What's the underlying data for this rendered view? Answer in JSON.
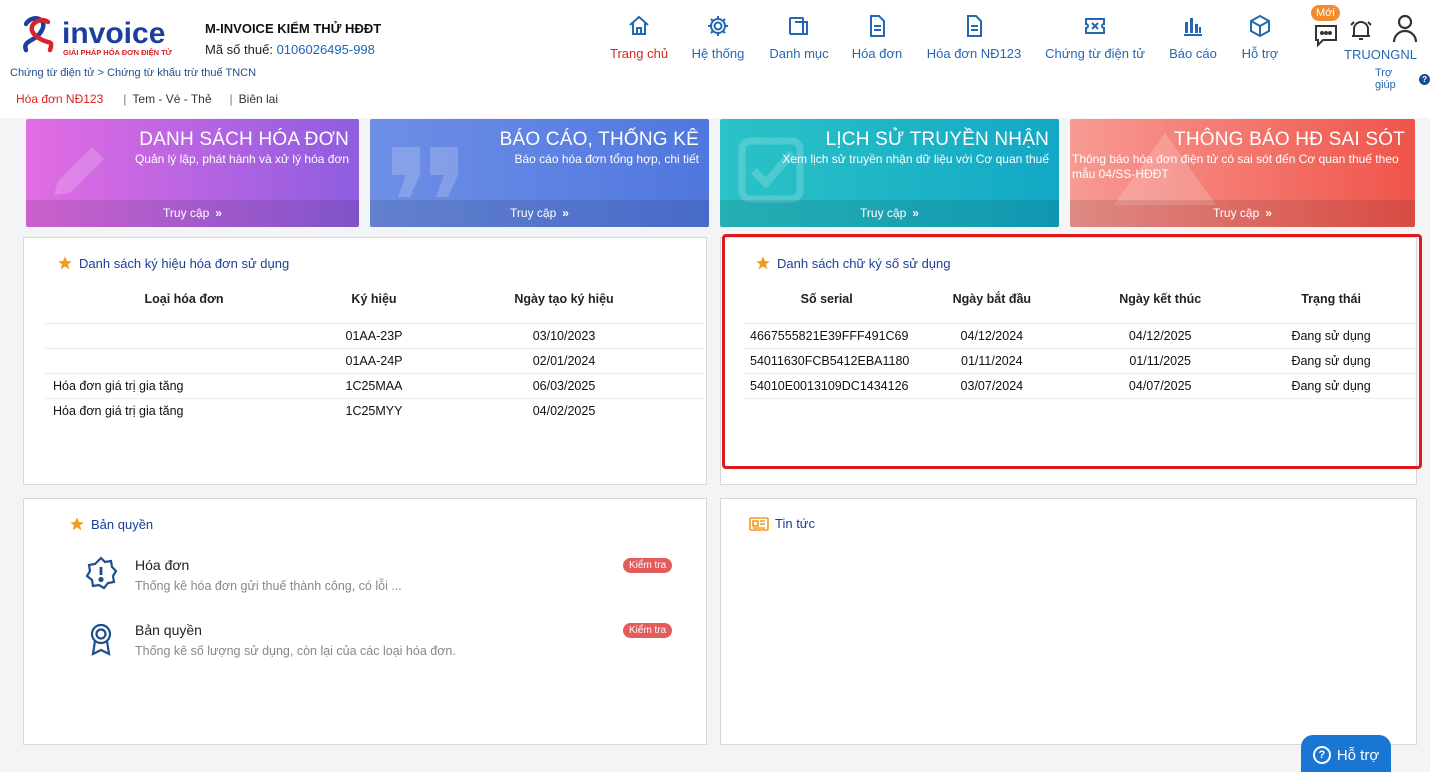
{
  "header": {
    "company_name": "M-INVOICE KIỂM THỬ HĐĐT",
    "tax_label": "Mã số thuế:",
    "tax_code": "0106026495-998",
    "breadcrumb": "Chứng từ điện tử > Chứng từ khấu trừ thuế TNCN",
    "logo_text": "invoice",
    "logo_tagline": "GIẢI PHÁP HÓA ĐƠN ĐIỆN TỬ"
  },
  "subnav": {
    "items": [
      {
        "label": "Hóa đơn NĐ123"
      },
      {
        "label": "Tem - Vé - Thẻ"
      },
      {
        "label": "Biên lai"
      }
    ]
  },
  "nav": {
    "items": [
      {
        "label": "Trang chủ",
        "icon": "home-icon"
      },
      {
        "label": "Hệ thống",
        "icon": "gear-icon"
      },
      {
        "label": "Danh mục",
        "icon": "catalog-icon"
      },
      {
        "label": "Hóa đơn",
        "icon": "document-icon"
      },
      {
        "label": "Hóa đơn NĐ123",
        "icon": "document-icon"
      },
      {
        "label": "Chứng từ điện tử",
        "icon": "ticket-icon"
      },
      {
        "label": "Báo cáo",
        "icon": "bar-chart-icon"
      },
      {
        "label": "Hỗ trợ",
        "icon": "cube-icon"
      }
    ]
  },
  "user": {
    "new_badge": "Mới",
    "username": "TRUONGNL",
    "help_link": "Trợ giúp"
  },
  "tiles": [
    {
      "title": "DANH SÁCH HÓA ĐƠN",
      "subtitle": "Quản lý lập, phát hành và xử lý hóa đơn",
      "footer": "Truy cập"
    },
    {
      "title": "BÁO CÁO, THỐNG KÊ",
      "subtitle": "Báo cáo hóa đơn tổng hợp, chi tiết",
      "footer": "Truy cập"
    },
    {
      "title": "LỊCH SỬ TRUYỀN NHẬN",
      "subtitle": "Xem lịch sử truyền nhận dữ liệu với Cơ quan thuế",
      "footer": "Truy cập"
    },
    {
      "title": "THÔNG BÁO HĐ SAI SÓT",
      "subtitle": "Thông báo hóa đơn điện tử có sai sót đến Cơ quan thuế theo mẫu 04/SS-HĐĐT",
      "footer": "Truy cập"
    }
  ],
  "symbols_panel": {
    "title": "Danh sách ký hiệu hóa đơn sử dụng",
    "columns": [
      "Loại hóa đơn",
      "Ký hiệu",
      "Ngày tạo ký hiệu"
    ],
    "rows": [
      {
        "type": "",
        "symbol": "01AA-23P",
        "date": "03/10/2023"
      },
      {
        "type": "",
        "symbol": "01AA-24P",
        "date": "02/01/2024"
      },
      {
        "type": "Hóa đơn giá trị gia tăng",
        "symbol": "1C25MAA",
        "date": "06/03/2025"
      },
      {
        "type": "Hóa đơn giá trị gia tăng",
        "symbol": "1C25MYY",
        "date": "04/02/2025"
      }
    ]
  },
  "signatures_panel": {
    "title": "Danh sách chữ ký số sử dụng",
    "columns": [
      "Số serial",
      "Ngày bắt đầu",
      "Ngày kết thúc",
      "Trạng thái"
    ],
    "rows": [
      {
        "serial": "4667555821E39FFF491C69",
        "start": "04/12/2024",
        "end": "04/12/2025",
        "status": "Đang sử dụng"
      },
      {
        "serial": "54011630FCB5412EBA1180",
        "start": "01/11/2024",
        "end": "01/11/2025",
        "status": "Đang sử dụng"
      },
      {
        "serial": "54010E0013109DC1434126",
        "start": "03/07/2024",
        "end": "04/07/2025",
        "status": "Đang sử dụng"
      }
    ]
  },
  "license_panel": {
    "title": "Bản quyền",
    "items": [
      {
        "name": "Hóa đơn",
        "desc": "Thống kê hóa đơn gửi thuế thành công, có lỗi ...",
        "badge": "Kiểm tra"
      },
      {
        "name": "Bản quyền",
        "desc": "Thống kê số lượng sử dụng, còn lại của các loại hóa đơn.",
        "badge": "Kiểm tra"
      }
    ]
  },
  "news_panel": {
    "title": "Tin tức"
  },
  "float_help": {
    "label": "Hỗ trợ"
  }
}
